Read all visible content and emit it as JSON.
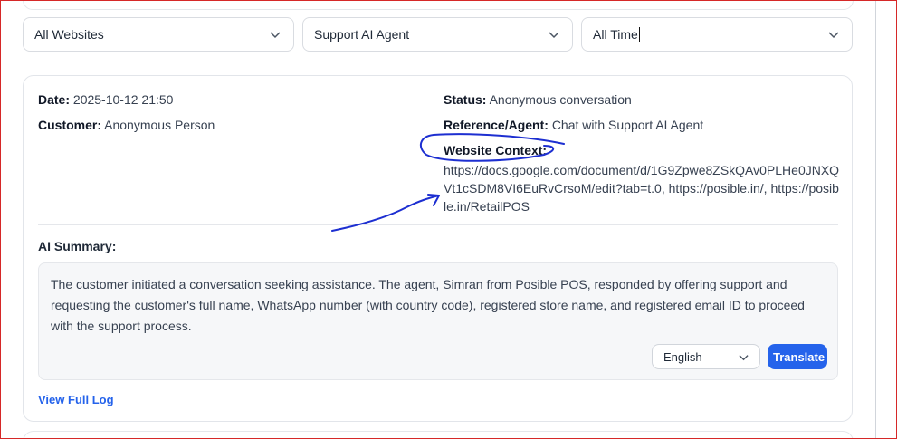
{
  "filters": {
    "website": "All Websites",
    "agent": "Support AI Agent",
    "time": "All Time"
  },
  "conversation": {
    "date_label": "Date:",
    "date_value": "2025-10-12 21:50",
    "customer_label": "Customer:",
    "customer_value": "Anonymous Person",
    "status_label": "Status:",
    "status_value": "Anonymous conversation",
    "reference_label": "Reference/Agent:",
    "reference_value": "Chat with Support AI Agent",
    "context_label": "Website Context:",
    "context_value": "https://docs.google.com/document/d/1G9Zpwe8ZSkQAv0PLHe0JNXQVt1cSDM8VI6EuRvCrsoM/edit?tab=t.0, https://posible.in/, https://posible.in/RetailPOS"
  },
  "ai_summary": {
    "label": "AI Summary:",
    "text": "The customer initiated a conversation seeking assistance. The agent, Simran from Posible POS, responded by offering support and requesting the customer's full name, WhatsApp number (with country code), registered store name, and registered email ID to proceed with the support process.",
    "language": "English",
    "translate_label": "Translate"
  },
  "view_full_log_label": "View Full Log",
  "colors": {
    "primary": "#2563eb",
    "annotation_ink": "#1d2fd1",
    "frame_border": "#d62828"
  },
  "icons": {
    "dropdown": "chevron-down-icon"
  }
}
